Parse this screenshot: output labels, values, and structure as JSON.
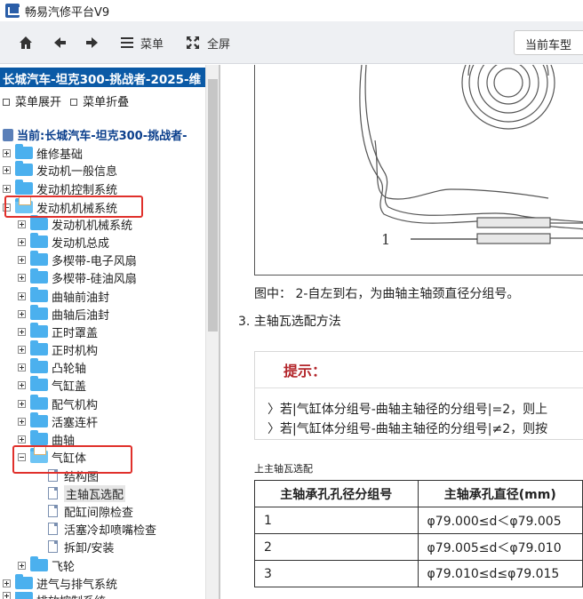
{
  "app": {
    "title": "畅易汽修平台V9"
  },
  "toolbar": {
    "menu_label": "菜单",
    "fullscreen_label": "全屏",
    "current_model_label": "当前车型"
  },
  "sidebar": {
    "header": "长城汽车-坦克300-挑战者-2025-维",
    "expand_all": "菜单展开",
    "collapse_all": "菜单折叠",
    "current": "当前:长城汽车-坦克300-挑战者-",
    "tree": [
      {
        "label": "维修基础"
      },
      {
        "label": "发动机一般信息"
      },
      {
        "label": "发动机控制系统"
      },
      {
        "label": "发动机机械系统"
      },
      {
        "label": "发动机机械系统"
      },
      {
        "label": "发动机总成"
      },
      {
        "label": "多楔带-电子风扇"
      },
      {
        "label": "多楔带-硅油风扇"
      },
      {
        "label": "曲轴前油封"
      },
      {
        "label": "曲轴后油封"
      },
      {
        "label": "正时罩盖"
      },
      {
        "label": "正时机构"
      },
      {
        "label": "凸轮轴"
      },
      {
        "label": "气缸盖"
      },
      {
        "label": "配气机构"
      },
      {
        "label": "活塞连杆"
      },
      {
        "label": "曲轴"
      },
      {
        "label": "气缸体"
      },
      {
        "label": "结构图"
      },
      {
        "label": "主轴瓦选配"
      },
      {
        "label": "配缸间隙检查"
      },
      {
        "label": "活塞冷却喷嘴检查"
      },
      {
        "label": "拆卸/安装"
      },
      {
        "label": "飞轮"
      },
      {
        "label": "进气与排气系统"
      },
      {
        "label": "排放控制系统"
      }
    ]
  },
  "content": {
    "figure_callout": "1",
    "figure_caption": "图中： 2-自左到右，为曲轴主轴颈直径分组号。",
    "section_heading": "3. 主轴瓦选配方法",
    "tip": {
      "title": "提示：",
      "lines": [
        "〉若|气缸体分组号-曲轴主轴径的分组号|=2，则上",
        "〉若|气缸体分组号-曲轴主轴径的分组号|≠2，则按"
      ]
    },
    "table_caption": "上主轴瓦选配",
    "table": {
      "headers": [
        "主轴承孔孔径分组号",
        "主轴承孔直径(mm)"
      ],
      "rows": [
        [
          "1",
          "φ79.000≤d＜φ79.005"
        ],
        [
          "2",
          "φ79.005≤d＜φ79.010"
        ],
        [
          "3",
          "φ79.010≤d≤φ79.015"
        ]
      ]
    }
  },
  "colors": {
    "header_blue": "#0b5aa6",
    "tip_red": "#b3262b",
    "highlight_red": "#e0302b",
    "folder_blue": "#4bb0ee"
  },
  "icons": [
    "home-icon",
    "back-arrow-icon",
    "forward-arrow-icon",
    "menu-icon",
    "fullscreen-icon",
    "folder-icon",
    "document-icon"
  ]
}
